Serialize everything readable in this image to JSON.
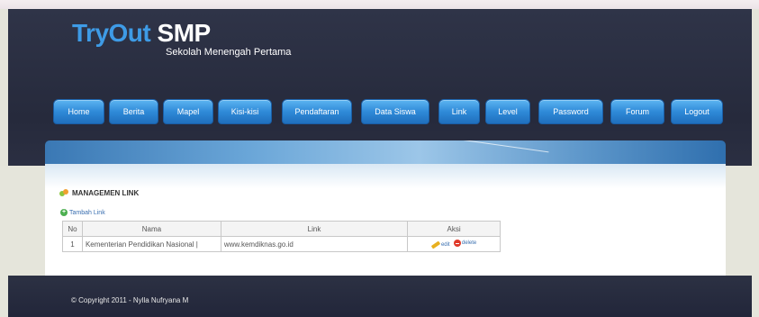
{
  "header": {
    "logo_tryout": "TryOut",
    "logo_smp": "SMP",
    "subtitle": "Sekolah Menengah Pertama"
  },
  "nav": {
    "items": [
      "Home",
      "Berita",
      "Mapel",
      "Kisi-kisi",
      "Pendaftaran",
      "Data Siswa",
      "Link",
      "Level",
      "Password",
      "Forum",
      "Logout"
    ]
  },
  "main": {
    "section_title": "MANAGEMEN LINK",
    "add_link_label": "Tambah Link",
    "table": {
      "headers": [
        "No",
        "Nama",
        "Link",
        "Aksi"
      ],
      "rows": [
        {
          "no": "1",
          "nama": "Kementerian Pendidikan Nasional |",
          "link": "www.kemdiknas.go.id",
          "edit": "edit",
          "delete": "delete"
        }
      ]
    }
  },
  "footer": {
    "copyright": "© Copyright 2011 - Nylla Nufryana M"
  },
  "colors": {
    "accent": "#3e9be6",
    "nav_button": "#2f8ad8",
    "dark_bg": "#2a2e40"
  }
}
